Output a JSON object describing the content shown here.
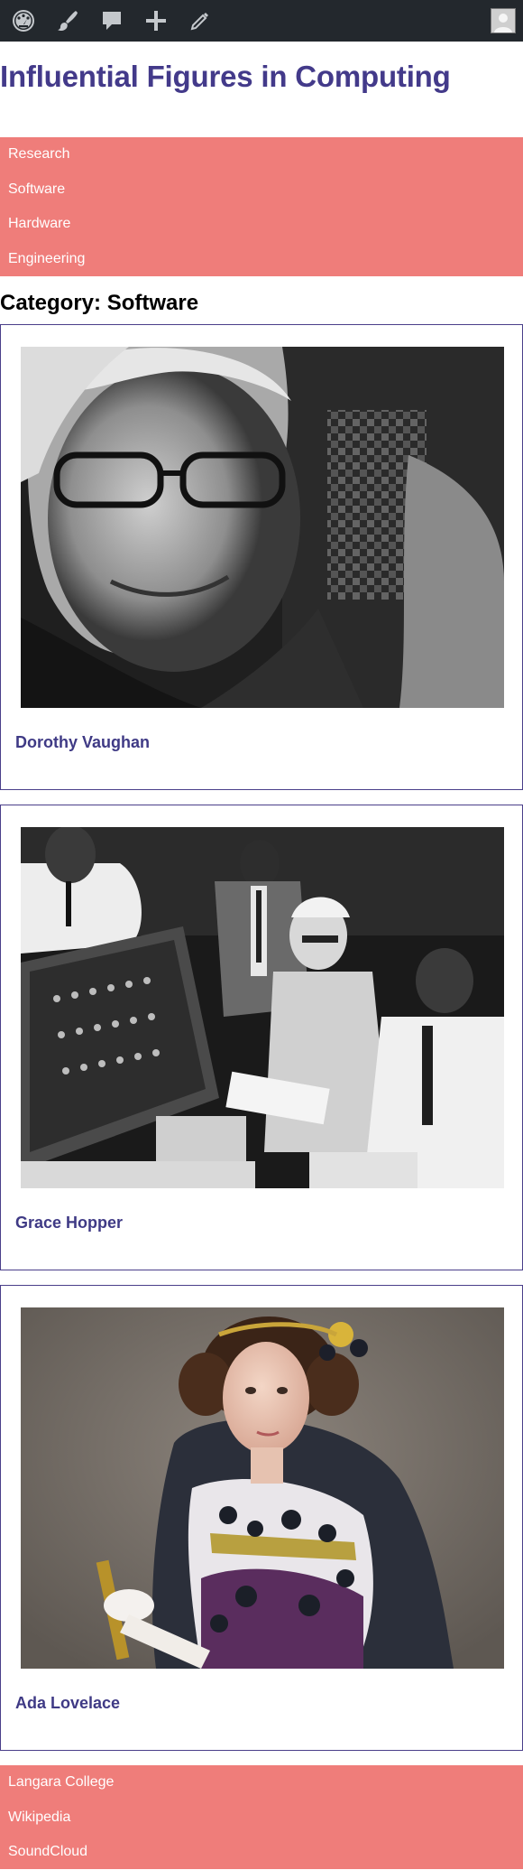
{
  "admin_bar": {
    "icons": [
      "dashboard-icon",
      "brush-icon",
      "comment-icon",
      "plus-icon",
      "pencil-icon"
    ],
    "avatar": "user-avatar"
  },
  "site": {
    "title": "Influential Figures in Computing"
  },
  "main_nav": {
    "items": [
      "Research",
      "Software",
      "Hardware",
      "Engineering"
    ]
  },
  "category": {
    "title": "Category: Software"
  },
  "posts": [
    {
      "name": "Dorothy Vaughan"
    },
    {
      "name": "Grace Hopper"
    },
    {
      "name": "Ada Lovelace"
    }
  ],
  "footer_nav": {
    "items": [
      "Langara College",
      "Wikipedia",
      "SoundCloud"
    ]
  },
  "colors": {
    "admin_bar": "#23282d",
    "brand": "#433a8a",
    "nav": "#ef7d7a"
  }
}
